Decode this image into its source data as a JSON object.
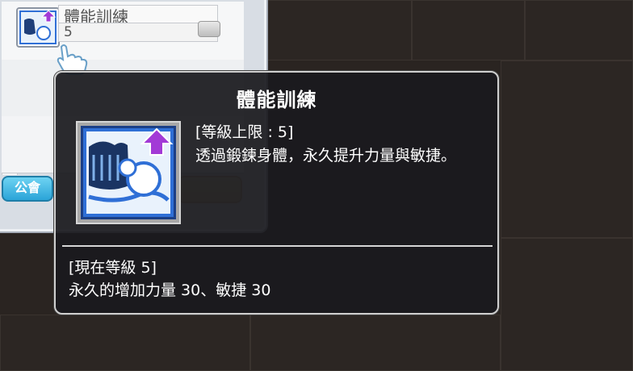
{
  "skill_window": {
    "skill_name": "體能訓練",
    "skill_level": "5",
    "guild_button_label": "公會"
  },
  "tooltip": {
    "title": "體能訓練",
    "max_level_line": "[等級上限 : 5]",
    "description": "透過鍛鍊身體，永久提升力量與敏捷。",
    "current_level_line": "[現在等級 5]",
    "current_effect": "永久的增加力量 30、敏捷 30"
  },
  "icons": {
    "skill_icon": "physical-training-skill-icon",
    "cursor": "hand-pointer-cursor",
    "upgrade_arrow": "purple-up-arrow"
  },
  "colors": {
    "tooltip_bg": "#1a1a1e",
    "tooltip_border": "#cfcfcf",
    "text": "#ffffff",
    "arrow": "#a23ad6",
    "icon_blue": "#2f6fd6"
  }
}
